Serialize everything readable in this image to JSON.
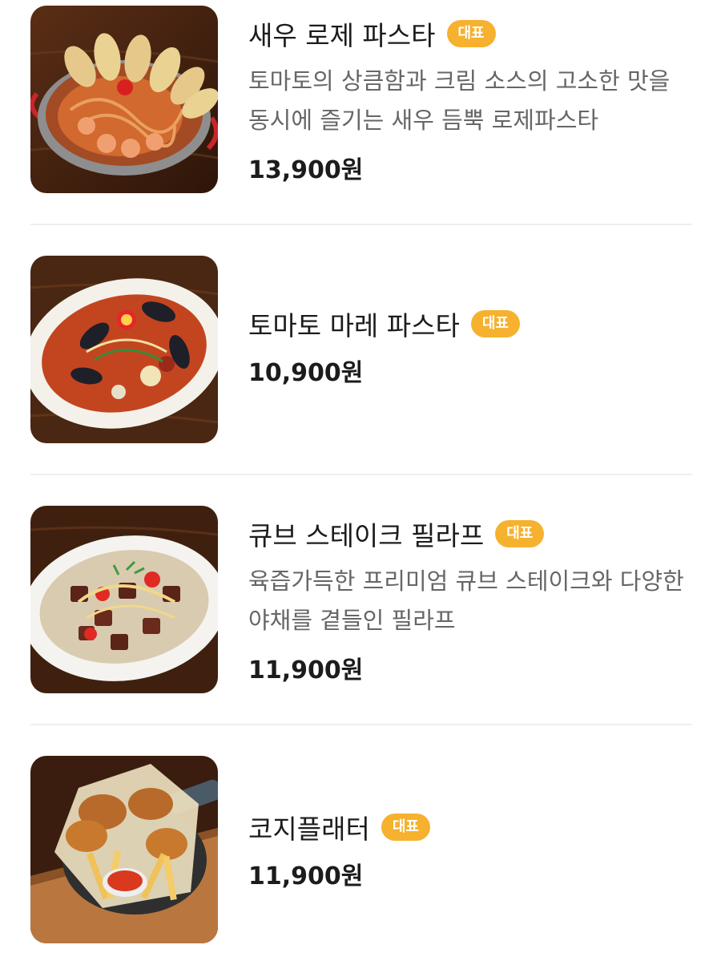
{
  "menu": {
    "items": [
      {
        "name": "새우 로제 파스타",
        "badge": "대표",
        "description": "토마토의 상큼함과 크림 소스의 고소한 맛을 동시에 즐기는 새우 듬뿍 로제파스타",
        "price": "13,900원",
        "image_icon": "shrimp-rose-pasta-photo"
      },
      {
        "name": "토마토 마레 파스타",
        "badge": "대표",
        "description": "",
        "price": "10,900원",
        "image_icon": "tomato-mare-pasta-photo"
      },
      {
        "name": "큐브 스테이크 필라프",
        "badge": "대표",
        "description": "육즙가득한 프리미엄 큐브 스테이크와 다양한 야채를 곁들인 필라프",
        "price": "11,900원",
        "image_icon": "cube-steak-pilaf-photo"
      },
      {
        "name": "코지플래터",
        "badge": "대표",
        "description": "",
        "price": "11,900원",
        "image_icon": "cozy-platter-photo"
      }
    ]
  },
  "colors": {
    "badge": "#f6b12e",
    "name": "#1c1c1c",
    "description": "#666666",
    "divider": "#efefef"
  }
}
